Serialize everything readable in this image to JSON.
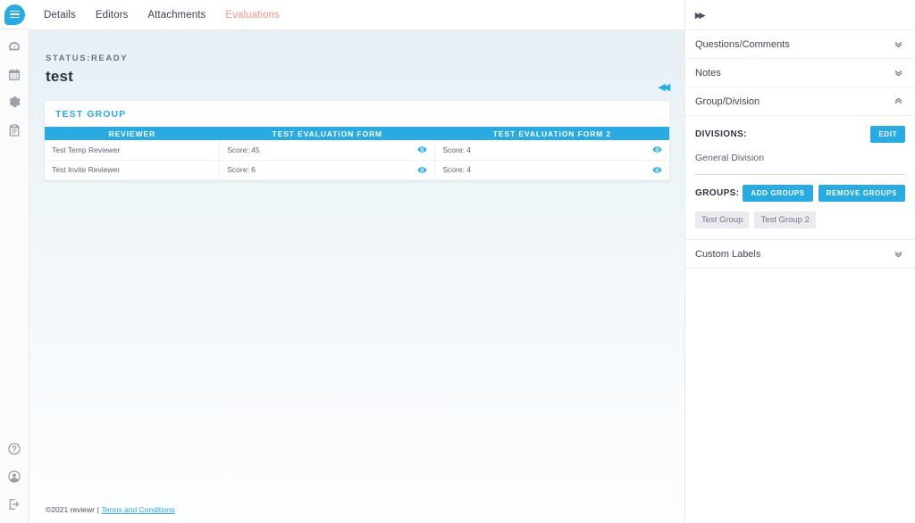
{
  "rail": {
    "logo_name": "reviewr-logo",
    "items": [
      {
        "name": "dashboard-icon",
        "label": "Dashboard"
      },
      {
        "name": "calendar-icon",
        "label": "Calendar"
      },
      {
        "name": "gear-icon",
        "label": "Settings"
      },
      {
        "name": "clipboard-icon",
        "label": "Submissions"
      }
    ],
    "bottom_items": [
      {
        "name": "help-icon",
        "label": "Help"
      },
      {
        "name": "account-icon",
        "label": "Account"
      },
      {
        "name": "logout-icon",
        "label": "Log out"
      }
    ]
  },
  "topbar": {
    "tabs": [
      {
        "label": "Details",
        "active": false
      },
      {
        "label": "Editors",
        "active": false
      },
      {
        "label": "Attachments",
        "active": false
      },
      {
        "label": "Evaluations",
        "active": true
      }
    ]
  },
  "main": {
    "status": "STATUS:READY",
    "title": "test",
    "collapse_glyph": "◂◂",
    "card": {
      "title": "TEST GROUP",
      "columns": [
        "REVIEWER",
        "TEST EVALUATION FORM",
        "TEST EVALUATION FORM 2"
      ],
      "rows": [
        {
          "reviewer": "Test Temp Reviewer",
          "form1": "Score: 45",
          "form2": "Score: 4"
        },
        {
          "reviewer": "Test Invite Reviewer",
          "form1": "Score: 6",
          "form2": "Score: 4"
        }
      ]
    }
  },
  "footer": {
    "copyright": "©2021 reviewr |",
    "link": "Terms and Conditions"
  },
  "right": {
    "expand_glyph": "▸▸",
    "sections": [
      {
        "label": "Questions/Comments",
        "expanded": false
      },
      {
        "label": "Notes",
        "expanded": false
      },
      {
        "label": "Group/Division",
        "expanded": true
      }
    ],
    "divisions": {
      "title": "DIVISIONS:",
      "edit_label": "EDIT",
      "value": "General Division"
    },
    "groups": {
      "title": "GROUPS:",
      "add_label": "ADD GROUPS",
      "remove_label": "REMOVE GROUPS",
      "chips": [
        "Test Group",
        "Test Group 2"
      ]
    },
    "custom_labels": {
      "label": "Custom Labels",
      "expanded": false
    }
  },
  "colors": {
    "accent": "#29abe2",
    "active_tab": "#f4938c",
    "chip_bg": "#e9ebee",
    "rail_icon": "#9aa0aa"
  }
}
